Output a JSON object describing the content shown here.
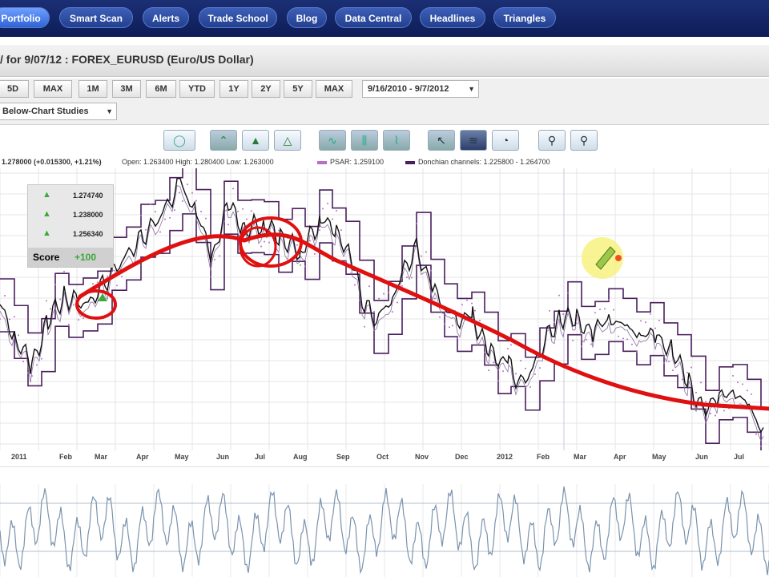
{
  "nav": {
    "items": [
      {
        "label": "Portfolio",
        "active": true
      },
      {
        "label": "Smart Scan"
      },
      {
        "label": "Alerts"
      },
      {
        "label": "Trade School"
      },
      {
        "label": "Blog"
      },
      {
        "label": "Data Central"
      },
      {
        "label": "Headlines"
      },
      {
        "label": "Triangles"
      }
    ]
  },
  "chart_title": "/ for 9/07/12 : FOREX_EURUSD (Euro/US Dollar)",
  "ranges": [
    "5D",
    "MAX",
    "1M",
    "3M",
    "6M",
    "YTD",
    "1Y",
    "2Y",
    "5Y",
    "MAX"
  ],
  "date_range": {
    "value": "9/16/2010 - 9/7/2012"
  },
  "studies_select": {
    "value": "Below-Chart Studies"
  },
  "toolbar_icons": [
    "speech-bubble-icon",
    "trend-up-icon",
    "triangle-up-icon",
    "triangle-alt-icon",
    "line-chart-icon",
    "bar-chart-icon",
    "candles-icon",
    "cursor-icon",
    "draw-lines-icon",
    "magnify-chart-icon",
    "zoom-in-icon",
    "zoom-out-icon"
  ],
  "infoline": {
    "price": "1.278000 (+0.015300, +1.21%)",
    "ohlc": "Open: 1.263400  High: 1.280400  Low: 1.263000",
    "psar": "PSAR: 1.259100",
    "donchian": "Donchian channels: 1.225800 - 1.264700",
    "psar_color": "#b86fc6",
    "donchian_color": "#4a1f5e"
  },
  "score_panel": {
    "rows": [
      "1.274740",
      "1.238000",
      "1.256340"
    ],
    "score_label": "Score",
    "score_value": "+100",
    "score_color": "#3aa83a"
  },
  "x_axis": [
    "2011",
    "Feb",
    "Mar",
    "Apr",
    "May",
    "Jun",
    "Jul",
    "Aug",
    "Sep",
    "Oct",
    "Nov",
    "Dec",
    "2012",
    "Feb",
    "Mar",
    "Apr",
    "May",
    "Jun",
    "Jul"
  ],
  "colors": {
    "annotation": "#e01010",
    "donchian": "#4a1f5e",
    "price": "#111111",
    "psar": "#b86fc6",
    "oscillator": "#7a93ad"
  }
}
